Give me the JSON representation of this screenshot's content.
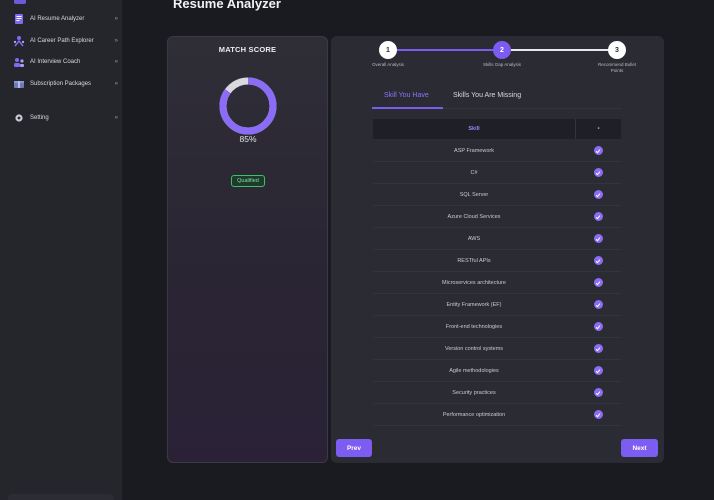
{
  "page": {
    "title": "Resume Analyzer"
  },
  "sidebar": {
    "items": [
      {
        "label": "AI Resume Analyzer",
        "icon": "resume-icon",
        "arrow": "»"
      },
      {
        "label": "AI Career Path Explorer",
        "icon": "career-path-icon",
        "arrow": "»"
      },
      {
        "label": "AI Interview Coach",
        "icon": "interview-icon",
        "arrow": "»"
      },
      {
        "label": "Subscription Packages",
        "icon": "package-icon",
        "arrow": "»"
      }
    ],
    "setting": {
      "label": "Setting",
      "icon": "gear-icon",
      "arrow": "»"
    }
  },
  "score_card": {
    "title": "MATCH SCORE",
    "percent_label": "85%",
    "percent": 85,
    "status": "Qualified",
    "accent": "#8b6cf6"
  },
  "stepper": {
    "steps": [
      {
        "number": "1",
        "label": "Overall Analysis"
      },
      {
        "number": "2",
        "label": "Skills Gap Analysis"
      },
      {
        "number": "3",
        "label": "Recommend Bullet Points"
      }
    ],
    "current": 2
  },
  "tabs": {
    "active": "Skill You Have",
    "inactive": "Skills You Are Missing"
  },
  "table": {
    "header_skill": "Skill",
    "header_check": "•",
    "rows": [
      "ASP Framework",
      "C#",
      "SQL Server",
      "Azure Cloud Services",
      "AWS",
      "RESTful APIs",
      "Microservices architecture",
      "Entity Framework (EF)",
      "Front-end technologies",
      "Version control systems",
      "Agile methodologies",
      "Security practices",
      "Performance optimization"
    ]
  },
  "buttons": {
    "prev": "Prev",
    "next": "Next"
  }
}
